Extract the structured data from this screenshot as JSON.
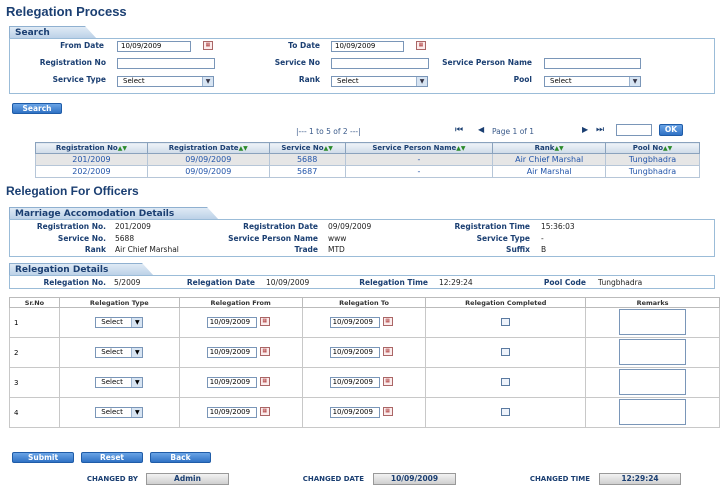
{
  "page_title": "Relegation Process",
  "search": {
    "tab": "Search",
    "from_date_label": "From Date",
    "from_date": "10/09/2009",
    "to_date_label": "To Date",
    "to_date": "10/09/2009",
    "reg_no_label": "Registration No",
    "service_no_label": "Service No",
    "service_person_label": "Service Person Name",
    "service_type_label": "Service Type",
    "service_type": "Select",
    "rank_label": "Rank",
    "rank": "Select",
    "pool_label": "Pool",
    "pool": "Select",
    "search_button": "Search"
  },
  "pager": {
    "range": "|--- 1   to   5   of   2 ---|",
    "page_info": "Page 1 of 1",
    "ok": "OK"
  },
  "results": {
    "columns": [
      "Registration No",
      "Registration Date",
      "Service No",
      "Service Person Name",
      "Rank",
      "Pool No"
    ],
    "rows": [
      [
        "201/2009",
        "09/09/2009",
        "5688",
        "-",
        "Air Chief Marshal",
        "Tungbhadra"
      ],
      [
        "202/2009",
        "09/09/2009",
        "5687",
        "-",
        "Air Marshal",
        "Tungbhadra"
      ]
    ]
  },
  "officers_title": "Relegation For Officers",
  "marriage": {
    "tab": "Marriage Accomodation Details",
    "reg_no_label": "Registration No.",
    "reg_no": "201/2009",
    "reg_date_label": "Registration Date",
    "reg_date": "09/09/2009",
    "reg_time_label": "Registration Time",
    "reg_time": "15:36:03",
    "service_no_label": "Service No.",
    "service_no": "5688",
    "person_label": "Service Person Name",
    "person": "www",
    "service_type_label": "Service Type",
    "service_type": "-",
    "rank_label": "Rank",
    "rank": "Air Chief Marshal",
    "trade_label": "Trade",
    "trade": "MTD",
    "suffix_label": "Suffix",
    "suffix": "B"
  },
  "relegation": {
    "tab": "Relegation Details",
    "no_label": "Relegation No.",
    "no": "5/2009",
    "date_label": "Relegation Date",
    "date": "10/09/2009",
    "time_label": "Relegation Time",
    "time": "12:29:24",
    "pool_label": "Pool Code",
    "pool": "Tungbhadra"
  },
  "rel_table": {
    "columns": [
      "Sr.No",
      "Relegation Type",
      "Relegation From",
      "Relegation To",
      "Relegation Completed",
      "Remarks"
    ],
    "rows": [
      {
        "sr": "1",
        "type": "Select",
        "from": "10/09/2009",
        "to": "10/09/2009"
      },
      {
        "sr": "2",
        "type": "Select",
        "from": "10/09/2009",
        "to": "10/09/2009"
      },
      {
        "sr": "3",
        "type": "Select",
        "from": "10/09/2009",
        "to": "10/09/2009"
      },
      {
        "sr": "4",
        "type": "Select",
        "from": "10/09/2009",
        "to": "10/09/2009"
      }
    ]
  },
  "actions": {
    "submit": "Submit",
    "reset": "Reset",
    "back": "Back"
  },
  "footer": {
    "changed_by_label": "CHANGED BY",
    "changed_by": "Admin",
    "changed_date_label": "CHANGED DATE",
    "changed_date": "10/09/2009",
    "changed_time_label": "CHANGED TIME",
    "changed_time": "12:29:24"
  }
}
